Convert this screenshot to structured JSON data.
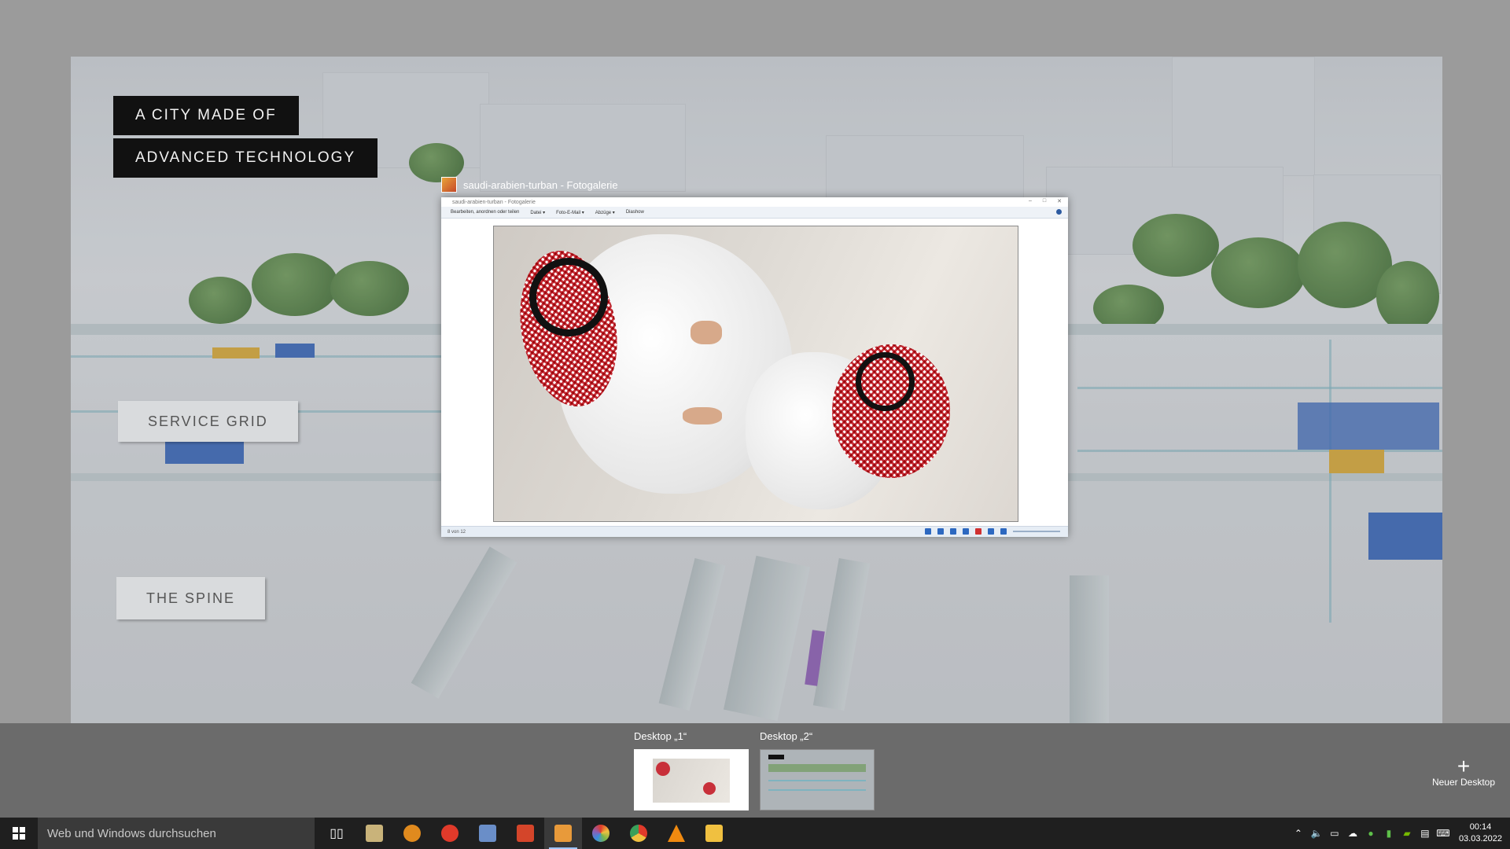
{
  "wallpaper": {
    "labels": {
      "city_line1": "A CITY MADE OF",
      "city_line2": "ADVANCED TECHNOLOGY",
      "service_grid": "SERVICE GRID",
      "the_spine": "THE SPINE"
    }
  },
  "window": {
    "caption": "saudi-arabien-turban - Fotogalerie",
    "inner_title": "saudi-arabien-turban - Fotogalerie",
    "menu": [
      "Bearbeiten, anordnen oder teilen",
      "Datei ▾",
      "Foto-E-Mail ▾",
      "Abzüge ▾",
      "Diashow"
    ],
    "status_text": "8 von 12"
  },
  "desktops": {
    "desktop1_label": "Desktop „1“",
    "desktop2_label": "Desktop „2“",
    "new_desktop_label": "Neuer Desktop"
  },
  "taskbar": {
    "search_placeholder": "Web und Windows durchsuchen",
    "apps": [
      {
        "name": "file-explorer-icon",
        "color": "#c9b37a"
      },
      {
        "name": "app-orange-icon",
        "color": "#e08a1e"
      },
      {
        "name": "opera-icon",
        "color": "#e03a2a"
      },
      {
        "name": "image-app-icon",
        "color": "#6a8ec8"
      },
      {
        "name": "adobe-icon",
        "color": "#d4452a"
      },
      {
        "name": "photo-gallery-icon",
        "color": "#e89a3a"
      },
      {
        "name": "picasa-icon",
        "color": "#7ab648"
      },
      {
        "name": "chrome-icon",
        "color": "#3a8ee0"
      },
      {
        "name": "vlc-icon",
        "color": "#f08a10"
      },
      {
        "name": "folder-icon",
        "color": "#f0c040"
      }
    ],
    "clock_time": "00:14",
    "clock_date": "03.03.2022"
  }
}
